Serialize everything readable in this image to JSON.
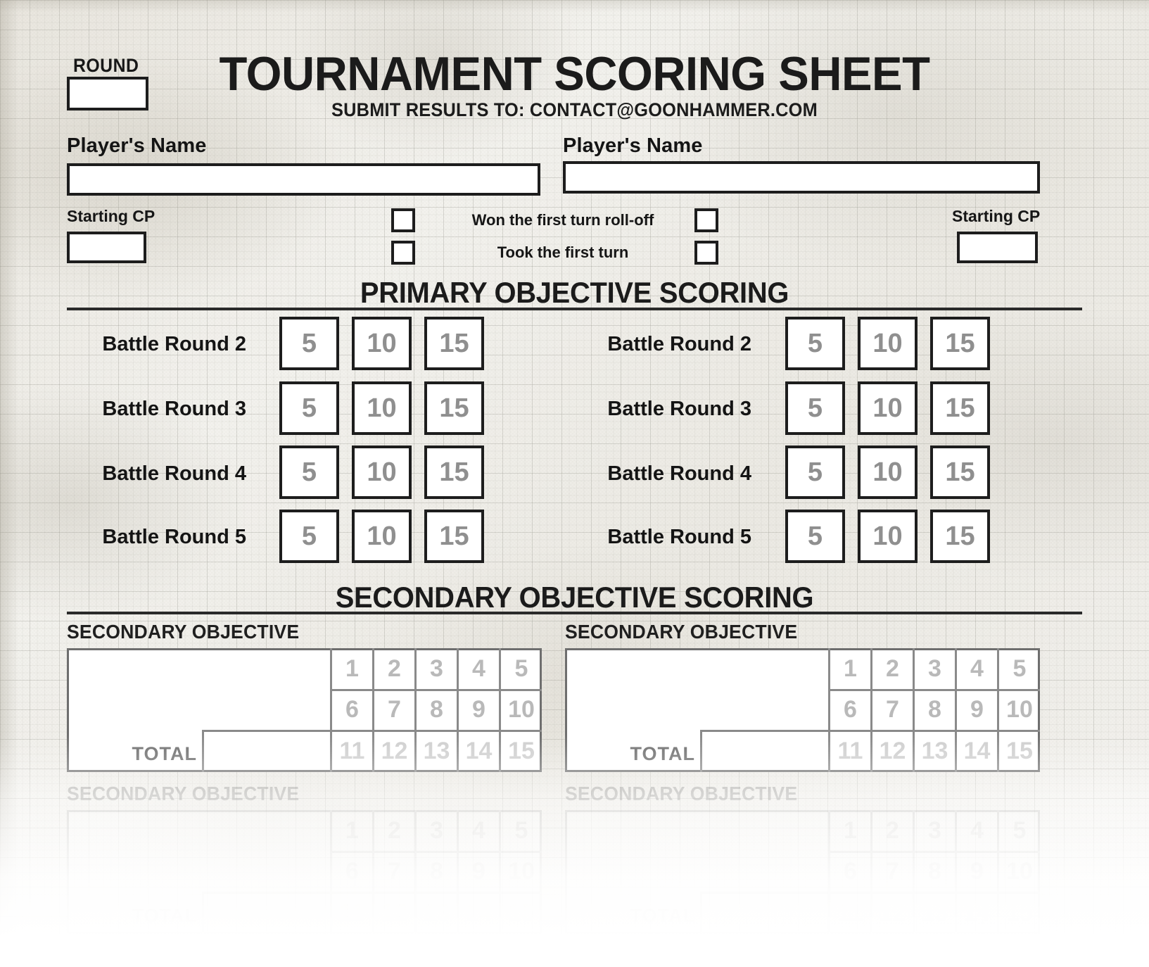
{
  "document": {
    "title": "TOURNAMENT SCORING SHEET",
    "subtitle": "SUBMIT RESULTS TO: CONTACT@GOONHAMMER.COM",
    "round_label": "ROUND",
    "round_value": ""
  },
  "players": {
    "left": {
      "name_label": "Player's Name",
      "name_value": "",
      "cp_label": "Starting CP",
      "cp_value": "",
      "won_rolloff_checked": false,
      "took_first_turn_checked": false
    },
    "right": {
      "name_label": "Player's Name",
      "name_value": "",
      "cp_label": "Starting CP",
      "cp_value": "",
      "won_rolloff_checked": false,
      "took_first_turn_checked": false
    }
  },
  "checkbox_rows": [
    "Won the first turn roll-off",
    "Took the first turn"
  ],
  "primary": {
    "section_title": "PRIMARY OBJECTIVE SCORING",
    "score_options": [
      "5",
      "10",
      "15"
    ],
    "rows": [
      "Battle Round 2",
      "Battle Round 3",
      "Battle Round 4",
      "Battle Round 5"
    ]
  },
  "secondary": {
    "section_title": "SECONDARY OBJECTIVE SCORING",
    "block_label": "SECONDARY OBJECTIVE",
    "total_label": "TOTAL",
    "total_value": "",
    "objective_value": "",
    "number_rows": [
      [
        "1",
        "2",
        "3",
        "4",
        "5"
      ],
      [
        "6",
        "7",
        "8",
        "9",
        "10"
      ],
      [
        "11",
        "12",
        "13",
        "14",
        "15"
      ]
    ]
  },
  "colors": {
    "ink": "#1b1b1b",
    "paper": "#efede8",
    "score_grey": "#8f8f8f",
    "table_grey": "#8a8a8a",
    "number_grey": "#b9b9b9"
  }
}
